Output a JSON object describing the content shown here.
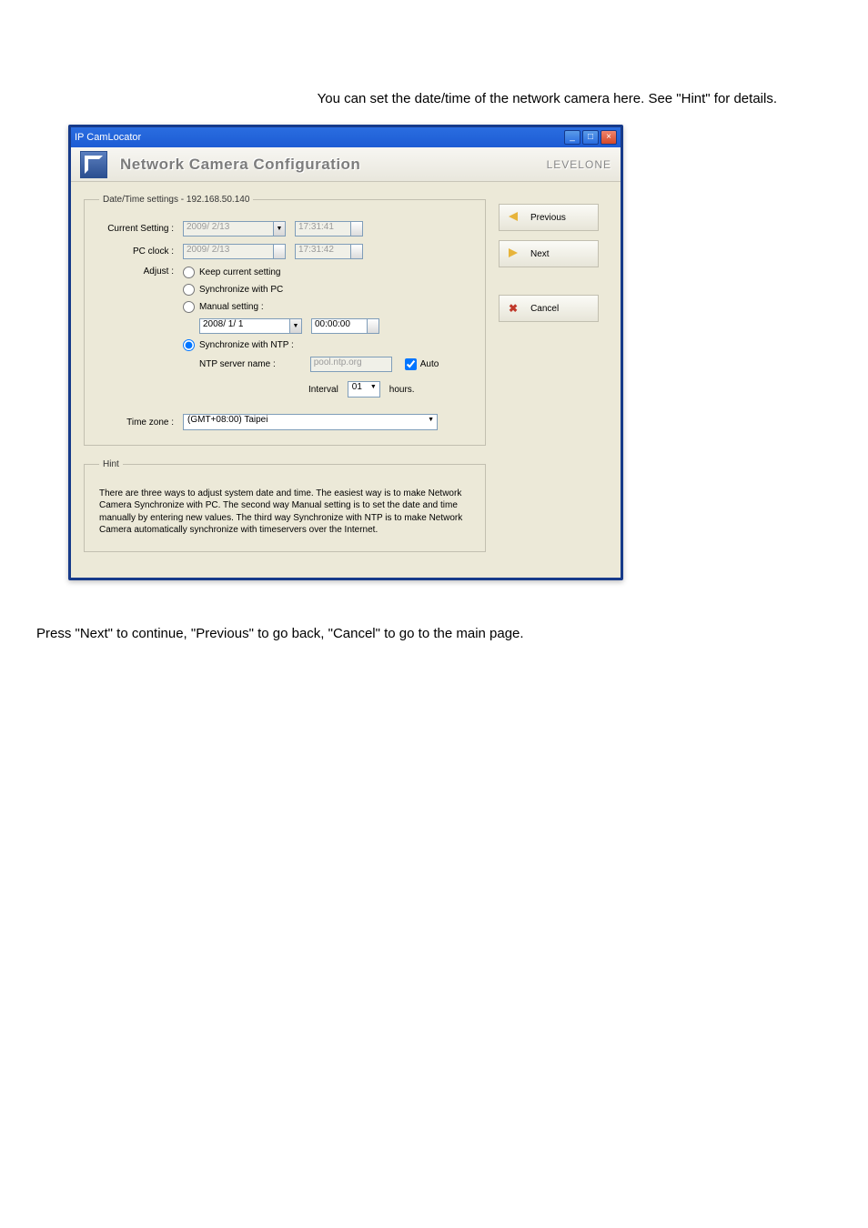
{
  "doc": {
    "intro": "You can set the date/time of the network camera here. See \"Hint\" for details.",
    "footer": "Press \"Next\" to continue, \"Previous\" to go back, \"Cancel\" to go to the main page."
  },
  "window": {
    "title": "IP CamLocator",
    "header_title": "Network Camera Configuration",
    "brand": "LEVELONE"
  },
  "nav": {
    "previous": "Previous",
    "next": "Next",
    "cancel": "Cancel"
  },
  "datetime": {
    "legend": "Date/Time settings - 192.168.50.140",
    "current_label": "Current Setting :",
    "current_date": "2009/ 2/13",
    "current_time": "17:31:41",
    "pc_label": "PC clock :",
    "pc_date": "2009/ 2/13",
    "pc_time": "17:31:42",
    "adjust_label": "Adjust :",
    "opt_keep": "Keep current setting",
    "opt_sync_pc": "Synchronize with PC",
    "opt_manual": "Manual setting :",
    "manual_date": "2008/ 1/ 1",
    "manual_time": "00:00:00",
    "opt_ntp": "Synchronize with NTP :",
    "ntp_server_label": "NTP server name :",
    "ntp_server_value": "pool.ntp.org",
    "ntp_auto": "Auto",
    "interval_label": "Interval",
    "interval_value": "01",
    "interval_unit": "hours.",
    "timezone_label": "Time zone :",
    "timezone_value": "(GMT+08:00) Taipei"
  },
  "hint": {
    "legend": "Hint",
    "text": "There are three ways to adjust system date and time. The easiest way is to make Network Camera Synchronize with PC. The second way Manual setting is to set the date and time manually by entering new values. The third way Synchronize with NTP is to make Network Camera automatically synchronize with timeservers over the Internet."
  }
}
